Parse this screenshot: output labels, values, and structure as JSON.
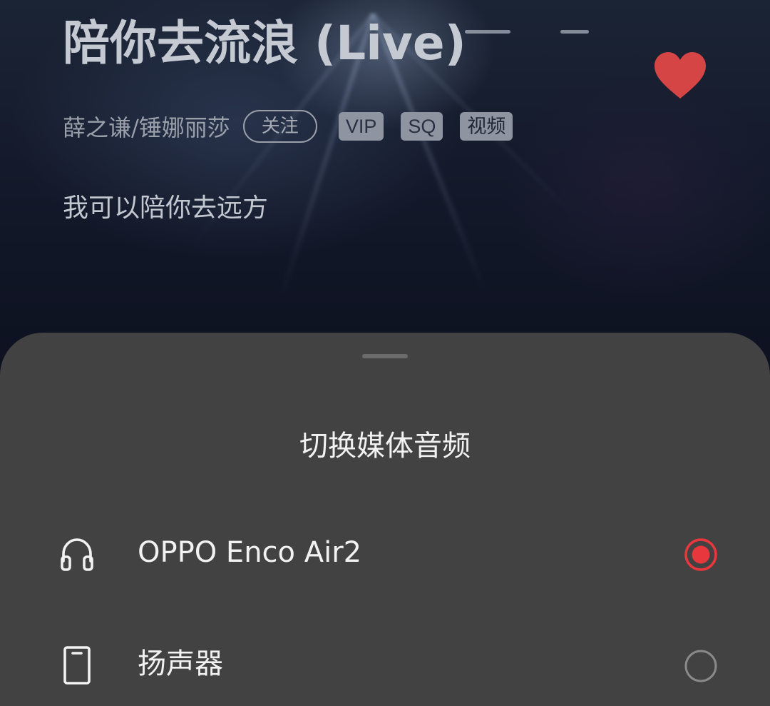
{
  "now_playing": {
    "title": "陪你去流浪 (Live)",
    "artists": "薛之谦/锤娜丽莎",
    "follow_label": "关注",
    "tags": [
      "VIP",
      "SQ",
      "视频"
    ],
    "lyric": "我可以陪你去远方",
    "liked": true
  },
  "audio_sheet": {
    "title": "切换媒体音频",
    "options": [
      {
        "label": "OPPO Enco Air2",
        "icon": "headphones-icon",
        "selected": true
      },
      {
        "label": "扬声器",
        "icon": "phone-speaker-icon",
        "selected": false
      }
    ]
  },
  "colors": {
    "accent": "#e8383d",
    "sheet_background": "#424242",
    "heart": "#d54545"
  }
}
